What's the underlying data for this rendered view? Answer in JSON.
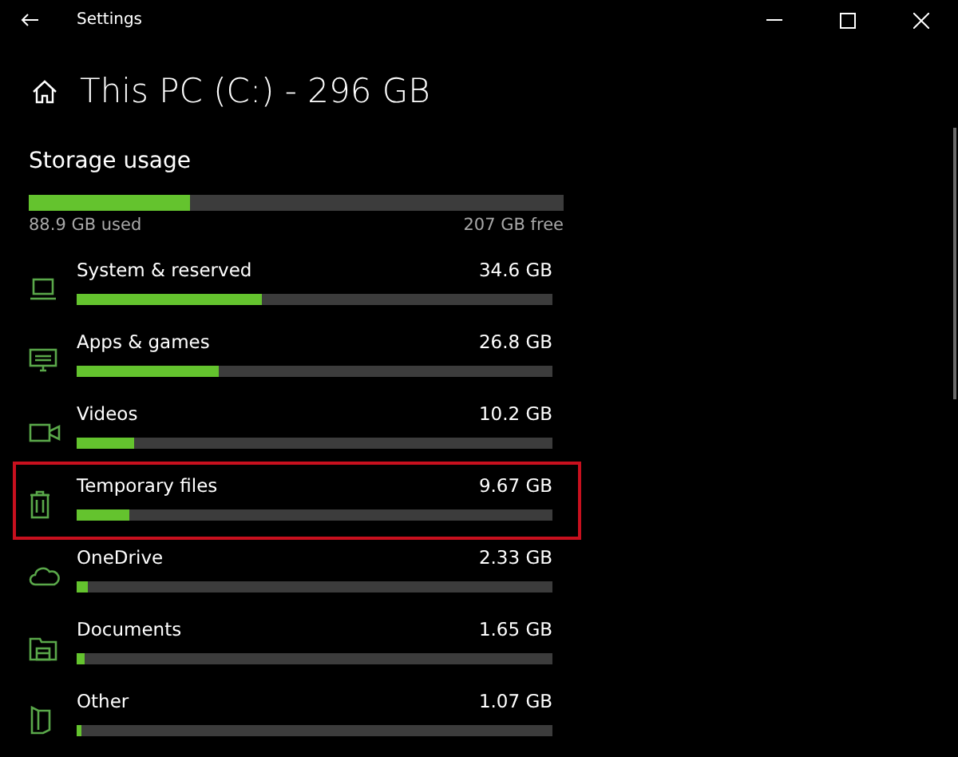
{
  "window": {
    "title": "Settings"
  },
  "header": {
    "title": "This PC (C:) - 296 GB"
  },
  "storage": {
    "heading": "Storage usage",
    "level": 0.3,
    "used": "88.9 GB used",
    "free": "207 GB free"
  },
  "categories": [
    {
      "kind": "system",
      "name": "System & reserved",
      "size": "34.6 GB",
      "level": 0.39,
      "highlighted": false
    },
    {
      "kind": "apps",
      "name": "Apps & games",
      "size": "26.8 GB",
      "level": 0.3,
      "highlighted": false
    },
    {
      "kind": "videos",
      "name": "Videos",
      "size": "10.2 GB",
      "level": 0.12,
      "highlighted": false
    },
    {
      "kind": "temp",
      "name": "Temporary files",
      "size": "9.67 GB",
      "level": 0.11,
      "highlighted": true
    },
    {
      "kind": "onedrive",
      "name": "OneDrive",
      "size": "2.33 GB",
      "level": 0.022,
      "highlighted": false
    },
    {
      "kind": "documents",
      "name": "Documents",
      "size": "1.65 GB",
      "level": 0.016,
      "highlighted": false
    },
    {
      "kind": "other",
      "name": "Other",
      "size": "1.07 GB",
      "level": 0.011,
      "highlighted": false
    }
  ]
}
